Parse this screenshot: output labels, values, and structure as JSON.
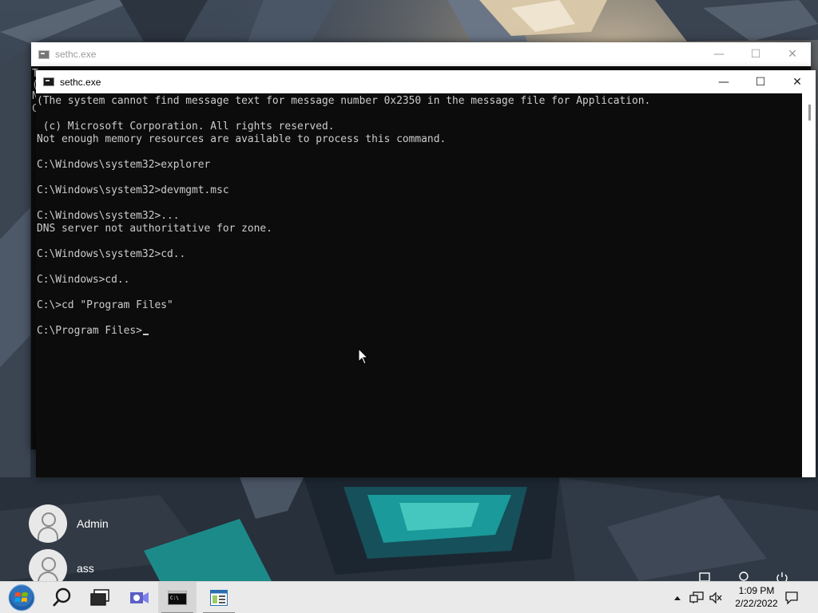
{
  "windows": {
    "back": {
      "title": "sethc.exe",
      "margin_glyphs": [
        "T",
        "(",
        "N",
        "C"
      ]
    },
    "front": {
      "title": "sethc.exe",
      "console_lines": [
        "(The system cannot find message text for message number 0x2350 in the message file for Application.",
        "",
        " (c) Microsoft Corporation. All rights reserved.",
        "Not enough memory resources are available to process this command.",
        "",
        "C:\\Windows\\system32>explorer",
        "",
        "C:\\Windows\\system32>devmgmt.msc",
        "",
        "C:\\Windows\\system32>...",
        "DNS server not authoritative for zone.",
        "",
        "C:\\Windows\\system32>cd..",
        "",
        "C:\\Windows>cd..",
        "",
        "C:\\>cd \"Program Files\"",
        ""
      ],
      "prompt": "C:\\Program Files>"
    },
    "controls": {
      "minimize": "—",
      "maximize": "☐",
      "close": "✕"
    }
  },
  "users": [
    {
      "name": "Admin",
      "icon": "user-avatar-icon"
    },
    {
      "name": "ass",
      "icon": "user-avatar-icon"
    }
  ],
  "taskbar": {
    "items": [
      {
        "icon": "start-orb-icon"
      },
      {
        "icon": "search-icon"
      },
      {
        "icon": "task-view-icon"
      },
      {
        "icon": "meet-now-icon"
      },
      {
        "icon": "command-prompt-icon",
        "active": true
      },
      {
        "icon": "app-window-icon",
        "running": true
      }
    ],
    "clock": {
      "time": "1:09 PM",
      "date": "2/22/2022"
    },
    "tray_icons": [
      "show-hidden-icons-icon",
      "network-icon",
      "volume-muted-icon",
      "notifications-icon"
    ]
  },
  "lock_screen_icons": [
    "accessibility-icon",
    "ease-of-access-icon",
    "power-icon"
  ],
  "colors": {
    "console_bg": "#0c0c0c",
    "console_fg": "#cccccc",
    "accent_teal": "#1a9a9a",
    "taskbar_bg": "#eaeaea"
  }
}
